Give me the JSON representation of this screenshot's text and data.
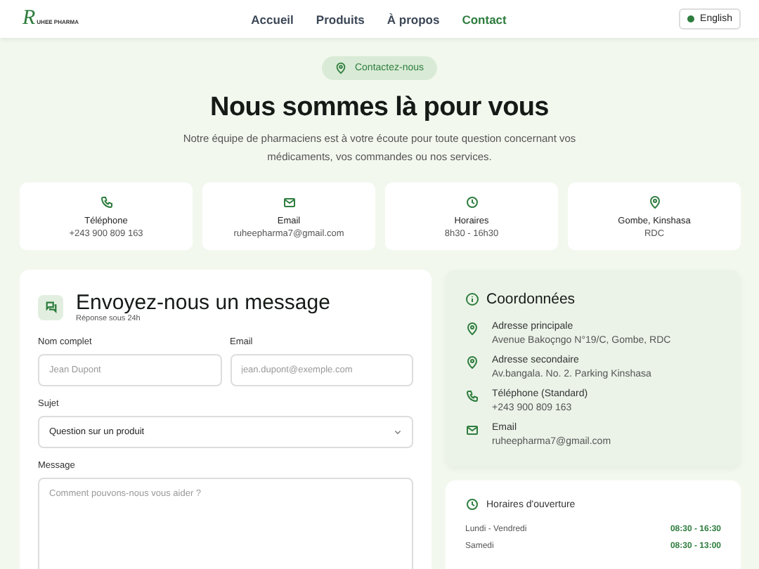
{
  "header": {
    "logo": {
      "initial": "R",
      "name": "UHEE PHARMA"
    },
    "nav": [
      {
        "label": "Accueil",
        "selected": false
      },
      {
        "label": "Produits",
        "selected": false
      },
      {
        "label": "À propos",
        "selected": false
      },
      {
        "label": "Contact",
        "selected": true
      }
    ],
    "language_button": "English"
  },
  "hero": {
    "badge": "Contactez-nous",
    "title": "Nous sommes là pour vous",
    "subtitle": "Notre équipe de pharmaciens est à votre écoute pour toute question concernant vos médicaments, vos commandes ou nos services."
  },
  "info_cards": [
    {
      "kind": "phone",
      "title": "Téléphone",
      "value": "+243 900 809 163"
    },
    {
      "kind": "mail",
      "title": "Email",
      "value": "ruheepharma7@gmail.com"
    },
    {
      "kind": "clock",
      "title": "Horaires",
      "value": "8h30 - 16h30"
    },
    {
      "kind": "pin",
      "title": "Gombe, Kinshasa",
      "value": "RDC"
    }
  ],
  "form": {
    "title": "Envoyez-nous un message",
    "subtitle": "Réponse sous 24h",
    "fields": [
      {
        "kind": "input",
        "label": "Nom complet",
        "placeholder": "Jean Dupont"
      },
      {
        "kind": "input",
        "label": "Email",
        "placeholder": "jean.dupont@exemple.com"
      },
      {
        "kind": "select",
        "label": "Sujet",
        "value": "Question sur un produit"
      },
      {
        "kind": "textarea",
        "label": "Message",
        "placeholder": "Comment pouvons-nous vous aider ?"
      }
    ]
  },
  "coordinates": {
    "title": "Coordonnées",
    "items": [
      {
        "kind": "pin",
        "title": "Adresse principale",
        "value": "Avenue Bakoçngo N°19/C, Gombe, RDC"
      },
      {
        "kind": "pin",
        "title": "Adresse secondaire",
        "value": "Av.bangala. No. 2. Parking Kinshasa"
      },
      {
        "kind": "phone",
        "title": "Téléphone (Standard)",
        "value": "+243 900 809 163"
      },
      {
        "kind": "mail",
        "title": "Email",
        "value": "ruheepharma7@gmail.com"
      }
    ]
  },
  "hours": {
    "title": "Horaires d'ouverture",
    "rows": [
      {
        "day": "Lundi - Vendredi",
        "time": "08:30 - 16:30"
      },
      {
        "day": "Samedi",
        "time": "08:30 - 13:00"
      }
    ]
  }
}
